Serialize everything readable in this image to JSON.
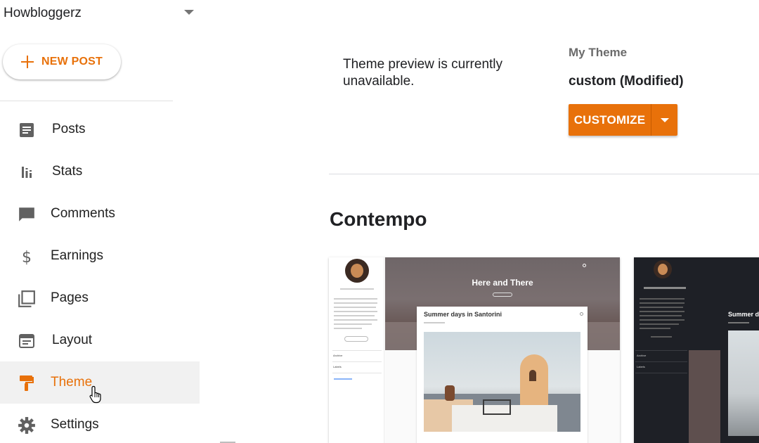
{
  "sidebar": {
    "blog_name": "Howbloggerz",
    "new_post_label": "NEW POST",
    "items": [
      {
        "label": "Posts",
        "icon": "posts-icon"
      },
      {
        "label": "Stats",
        "icon": "stats-icon"
      },
      {
        "label": "Comments",
        "icon": "comments-icon"
      },
      {
        "label": "Earnings",
        "icon": "earnings-icon"
      },
      {
        "label": "Pages",
        "icon": "pages-icon"
      },
      {
        "label": "Layout",
        "icon": "layout-icon"
      },
      {
        "label": "Theme",
        "icon": "theme-icon",
        "active": true
      },
      {
        "label": "Settings",
        "icon": "settings-icon"
      }
    ]
  },
  "main": {
    "preview_message": "Theme preview is currently unavailable.",
    "my_theme_label": "My Theme",
    "current_theme": "custom (Modified)",
    "customize_label": "CUSTOMIZE",
    "section_title": "Contempo",
    "cards": [
      {
        "hero_title": "Here and There",
        "post_title": "Summer days in Santorini",
        "side_labels": [
          "Archive",
          "Labels"
        ]
      },
      {
        "post_title": "Summer da",
        "side_labels": [
          "Archive",
          "Labels"
        ]
      }
    ]
  },
  "colors": {
    "accent": "#e8710a",
    "active_bg": "#f1f1f1",
    "text": "#212121",
    "icon_gray": "#616161"
  }
}
